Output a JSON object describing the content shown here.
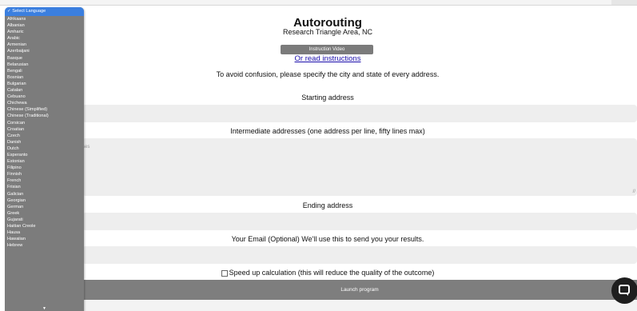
{
  "page": {
    "title": "Autorouting",
    "subtitle": "Research Triangle Area, NC",
    "video_button": "Instruction Video",
    "instructions_link": "Or read instructions",
    "note": "To avoid confusion, please specify the city and state of every address.",
    "starting_label": "Starting address",
    "intermediate_label": "Intermediate addresses (one address per line, fifty lines max)",
    "intermediate_placeholder": "ses",
    "ending_label": "Ending address",
    "email_label": "Your Email (Optional) We'll use this to send you your results.",
    "speedup_label": "Speed up calculation (this will reduce the quality of the outcome)",
    "launch_button": "Launch program",
    "resize_grip": "//"
  },
  "language_menu": {
    "selected": "✓ Select Language",
    "options": [
      "Afrikaans",
      "Albanian",
      "Amharic",
      "Arabic",
      "Armenian",
      "Azerbaijani",
      "Basque",
      "Belarusian",
      "Bengali",
      "Bosnian",
      "Bulgarian",
      "Catalan",
      "Cebuano",
      "Chichewa",
      "Chinese (Simplified)",
      "Chinese (Traditional)",
      "Corsican",
      "Croatian",
      "Czech",
      "Danish",
      "Dutch",
      "Esperanto",
      "Estonian",
      "Filipino",
      "Finnish",
      "French",
      "Frisian",
      "Galician",
      "Georgian",
      "German",
      "Greek",
      "Gujarati",
      "Haitian Creole",
      "Hausa",
      "Hawaiian",
      "Hebrew"
    ],
    "scroll_arrow": "▼"
  },
  "icons": {
    "chat": "chat-bubble-icon",
    "scroll": "chevron-down-icon"
  },
  "colors": {
    "link": "#1a0dab",
    "menu_bg": "#7c7c7c",
    "menu_selected": "#3b7fdf",
    "button_bg": "#7e7e7e",
    "chat_bg": "#1e1e1e"
  }
}
